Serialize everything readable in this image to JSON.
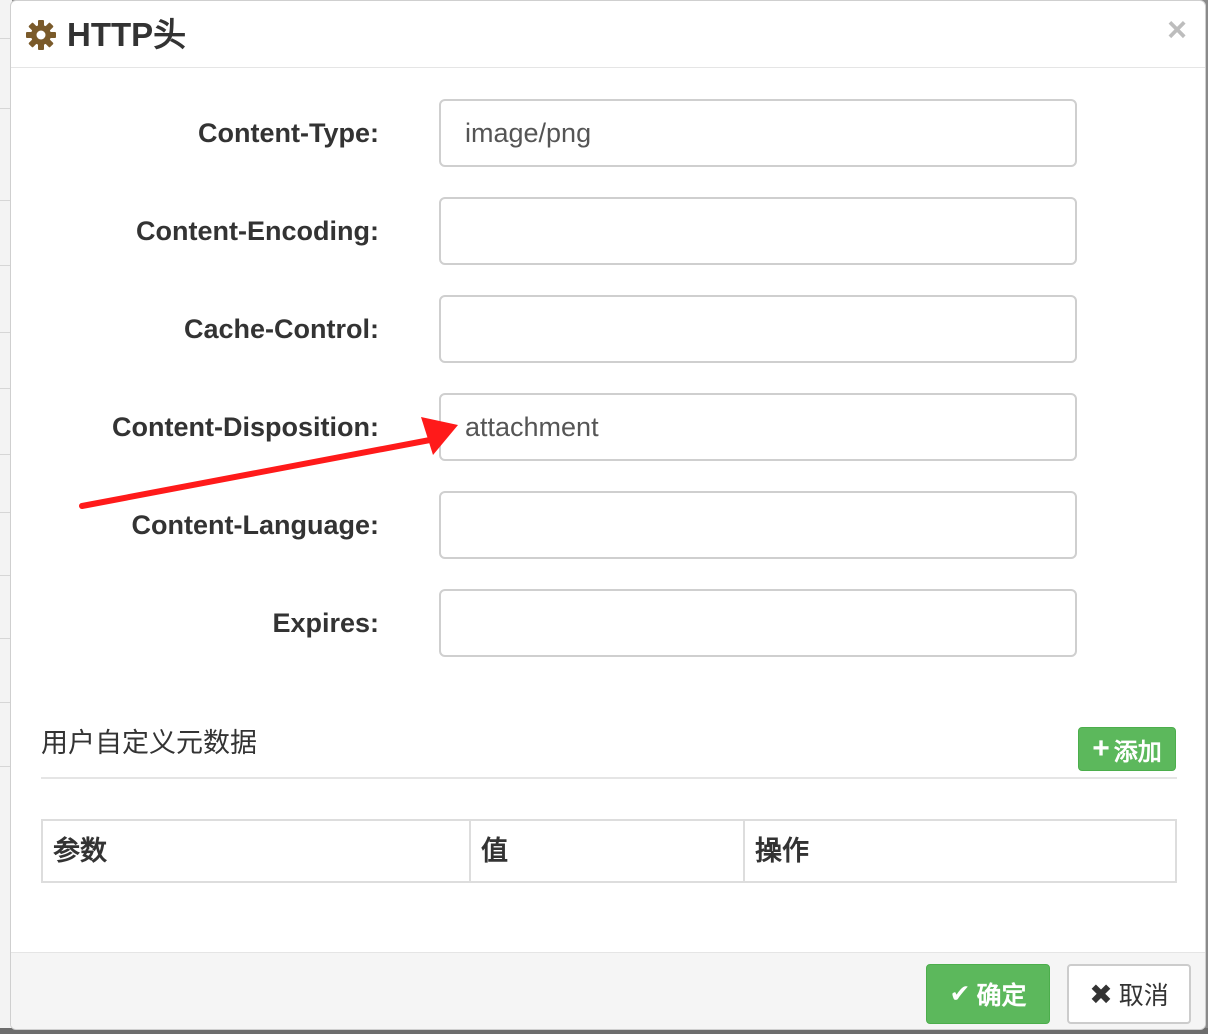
{
  "dialog": {
    "title": "HTTP头",
    "close_symbol": "×"
  },
  "fields": [
    {
      "label": "Content-Type:",
      "value": "image/png"
    },
    {
      "label": "Content-Encoding:",
      "value": ""
    },
    {
      "label": "Cache-Control:",
      "value": ""
    },
    {
      "label": "Content-Disposition:",
      "value": "attachment"
    },
    {
      "label": "Content-Language:",
      "value": ""
    },
    {
      "label": "Expires:",
      "value": ""
    }
  ],
  "metadata": {
    "title": "用户自定义元数据",
    "add_label": "添加",
    "add_icon": "+",
    "columns": [
      "参数",
      "值",
      "操作"
    ]
  },
  "footer": {
    "ok_label": "确定",
    "ok_icon": "✔",
    "cancel_label": "取消",
    "cancel_icon": "✖"
  },
  "colors": {
    "success": "#5cb85c",
    "arrow": "#ff1a1a",
    "gear": "#7a5a2a"
  },
  "icons": [
    "gear-icon",
    "close-icon",
    "plus-icon",
    "check-icon",
    "times-icon",
    "arrow-annotation"
  ]
}
